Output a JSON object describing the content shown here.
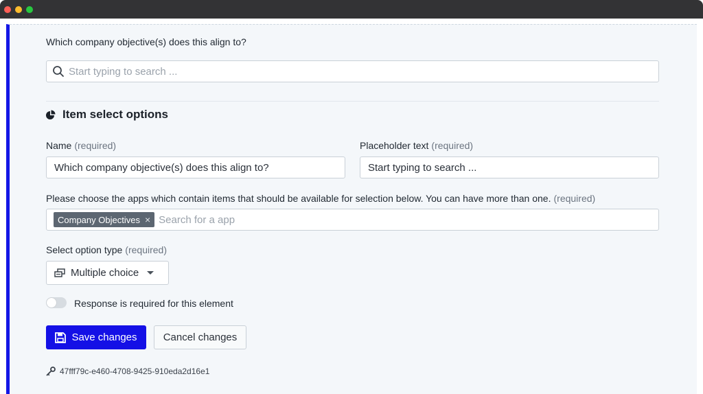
{
  "window": {
    "controls": [
      "close",
      "minimize",
      "maximize"
    ]
  },
  "objective_field": {
    "question": "Which company objective(s) does this align to?",
    "search_placeholder": "Start typing to search ..."
  },
  "section": {
    "title": "Item select options",
    "icon": "pie-chart-icon"
  },
  "name_field": {
    "label": "Name",
    "required": "(required)",
    "value": "Which company objective(s) does this align to?"
  },
  "placeholder_field": {
    "label": "Placeholder text",
    "required": "(required)",
    "value": "Start typing to search ..."
  },
  "apps_field": {
    "label": "Please choose the apps which contain items that should be available for selection below. You can have more than one.",
    "required": "(required)",
    "chips": [
      {
        "label": "Company Objectives",
        "remove": "×"
      }
    ],
    "search_placeholder": "Search for a app"
  },
  "option_type": {
    "label": "Select option type",
    "required": "(required)",
    "selected": "Multiple choice",
    "icon": "multiple-choice-icon"
  },
  "response_required": {
    "label": "Response is required for this element",
    "enabled": false
  },
  "actions": {
    "save_label": "Save changes",
    "cancel_label": "Cancel changes"
  },
  "element_id": {
    "value": "47fff79c-e460-4708-9425-910eda2d16e1",
    "icon": "key-icon"
  },
  "colors": {
    "accent": "#1410e6",
    "panel_bg": "#f4f7fa",
    "chip_bg": "#5c6671"
  }
}
